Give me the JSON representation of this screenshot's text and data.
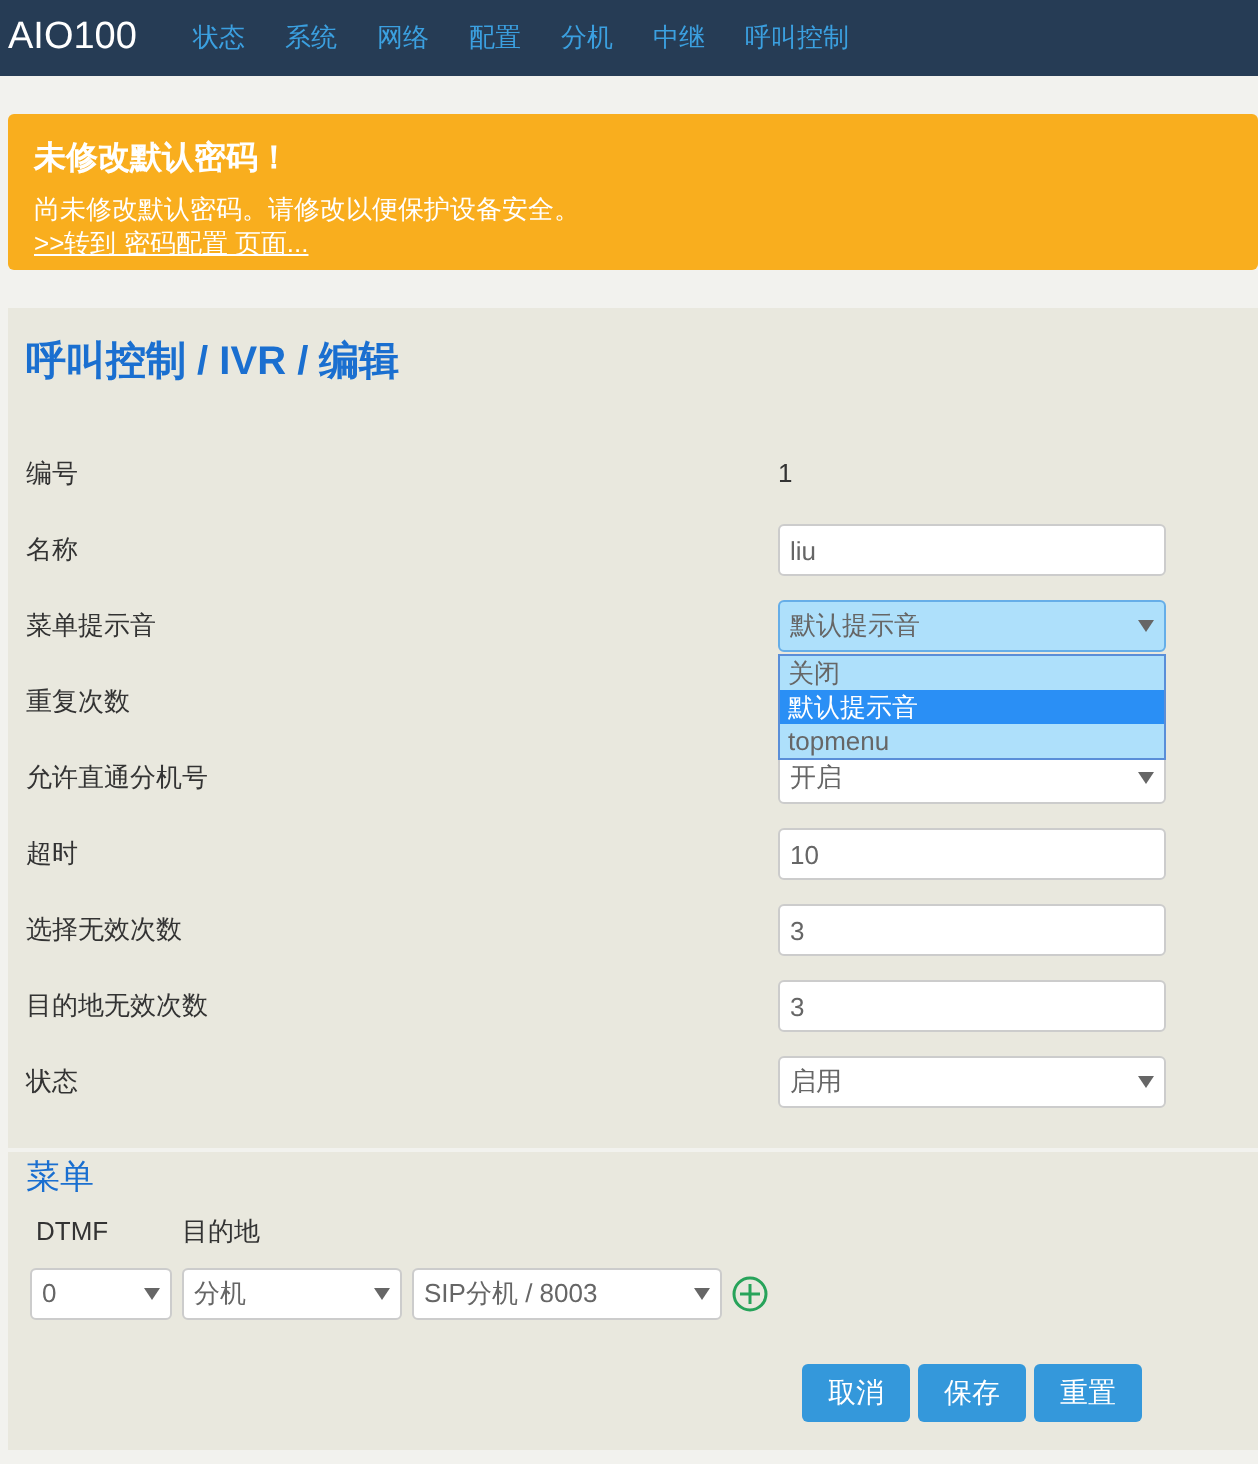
{
  "navbar": {
    "brand": "AIO100",
    "links": [
      {
        "label": "状态"
      },
      {
        "label": "系统"
      },
      {
        "label": "网络"
      },
      {
        "label": "配置"
      },
      {
        "label": "分机"
      },
      {
        "label": "中继"
      },
      {
        "label": "呼叫控制"
      }
    ]
  },
  "alert": {
    "title": "未修改默认密码！",
    "message": "尚未修改默认密码。请修改以便保护设备安全。",
    "link": ">>转到 密码配置 页面..."
  },
  "page_title": "呼叫控制 / IVR / 编辑",
  "form": [
    {
      "label": "编号",
      "field": {
        "kind": "static",
        "value": "1"
      }
    },
    {
      "label": "名称",
      "field": {
        "kind": "input",
        "value": "liu"
      }
    },
    {
      "label": "菜单提示音",
      "field": {
        "kind": "select",
        "value": "默认提示音",
        "expanded": true,
        "options": [
          {
            "label": "关闭",
            "selected": false
          },
          {
            "label": "默认提示音",
            "selected": true
          },
          {
            "label": "topmenu",
            "selected": false
          }
        ]
      }
    },
    {
      "label": "重复次数"
    },
    {
      "label": "允许直通分机号",
      "field": {
        "kind": "select",
        "value": "开启",
        "expanded": false
      }
    },
    {
      "label": "超时",
      "field": {
        "kind": "input",
        "value": "10"
      }
    },
    {
      "label": "选择无效次数",
      "field": {
        "kind": "input",
        "value": "3"
      }
    },
    {
      "label": "目的地无效次数",
      "field": {
        "kind": "input",
        "value": "3"
      }
    },
    {
      "label": "状态",
      "field": {
        "kind": "select",
        "value": "启用",
        "expanded": false
      }
    }
  ],
  "menu": {
    "title": "菜单",
    "columns": [
      "DTMF",
      "目的地"
    ],
    "entries": [
      {
        "dtmf": "0",
        "destination_type": "分机",
        "destination": "SIP分机 / 8003"
      }
    ]
  },
  "buttons": [
    "取消",
    "保存",
    "重置"
  ]
}
